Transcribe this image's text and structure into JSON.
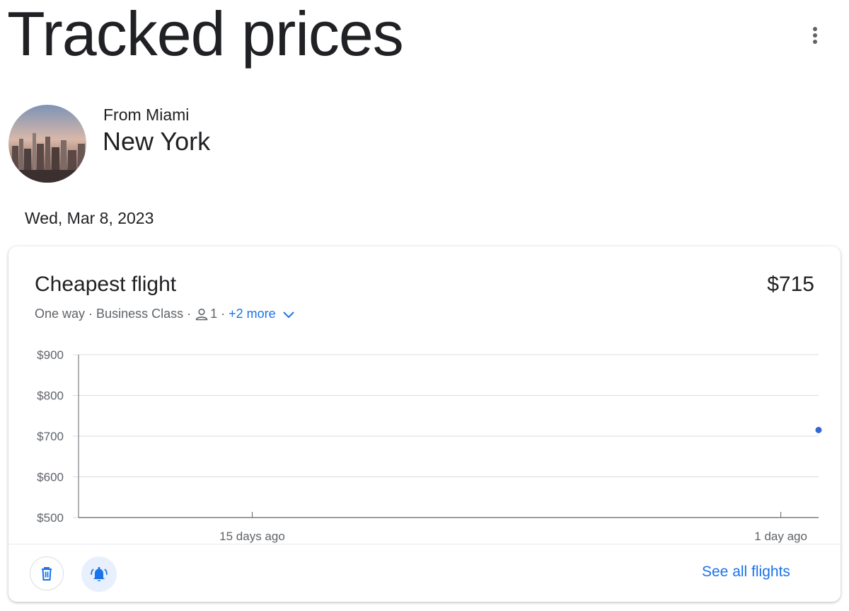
{
  "page": {
    "title": "Tracked prices"
  },
  "icons": {
    "more": "more-vert-icon",
    "person": "person-icon",
    "chevron": "chevron-down-icon",
    "trash": "trash-icon",
    "alert": "notification-bell-icon"
  },
  "colors": {
    "accent": "#1a73e8",
    "point": "#3367d6",
    "alert_bg": "#e8f0fe"
  },
  "trip": {
    "from_label": "From Miami",
    "destination": "New York",
    "date": "Wed, Mar 8, 2023"
  },
  "card": {
    "title": "Cheapest flight",
    "price": "$715",
    "trip_type": "One way",
    "cabin_class": "Business Class",
    "passengers": "1",
    "more_link": "+2 more",
    "see_all_label": "See all flights"
  },
  "chart_data": {
    "type": "scatter",
    "y_ticks": [
      "$900",
      "$800",
      "$700",
      "$600",
      "$500"
    ],
    "ylim": [
      500,
      900
    ],
    "x_ticks": [
      "15 days ago",
      "1 day ago"
    ],
    "x_tick_days": [
      15,
      1
    ],
    "xlim": [
      19.6,
      0
    ],
    "points": [
      {
        "x": 0,
        "y": 715
      }
    ],
    "grid": true
  }
}
